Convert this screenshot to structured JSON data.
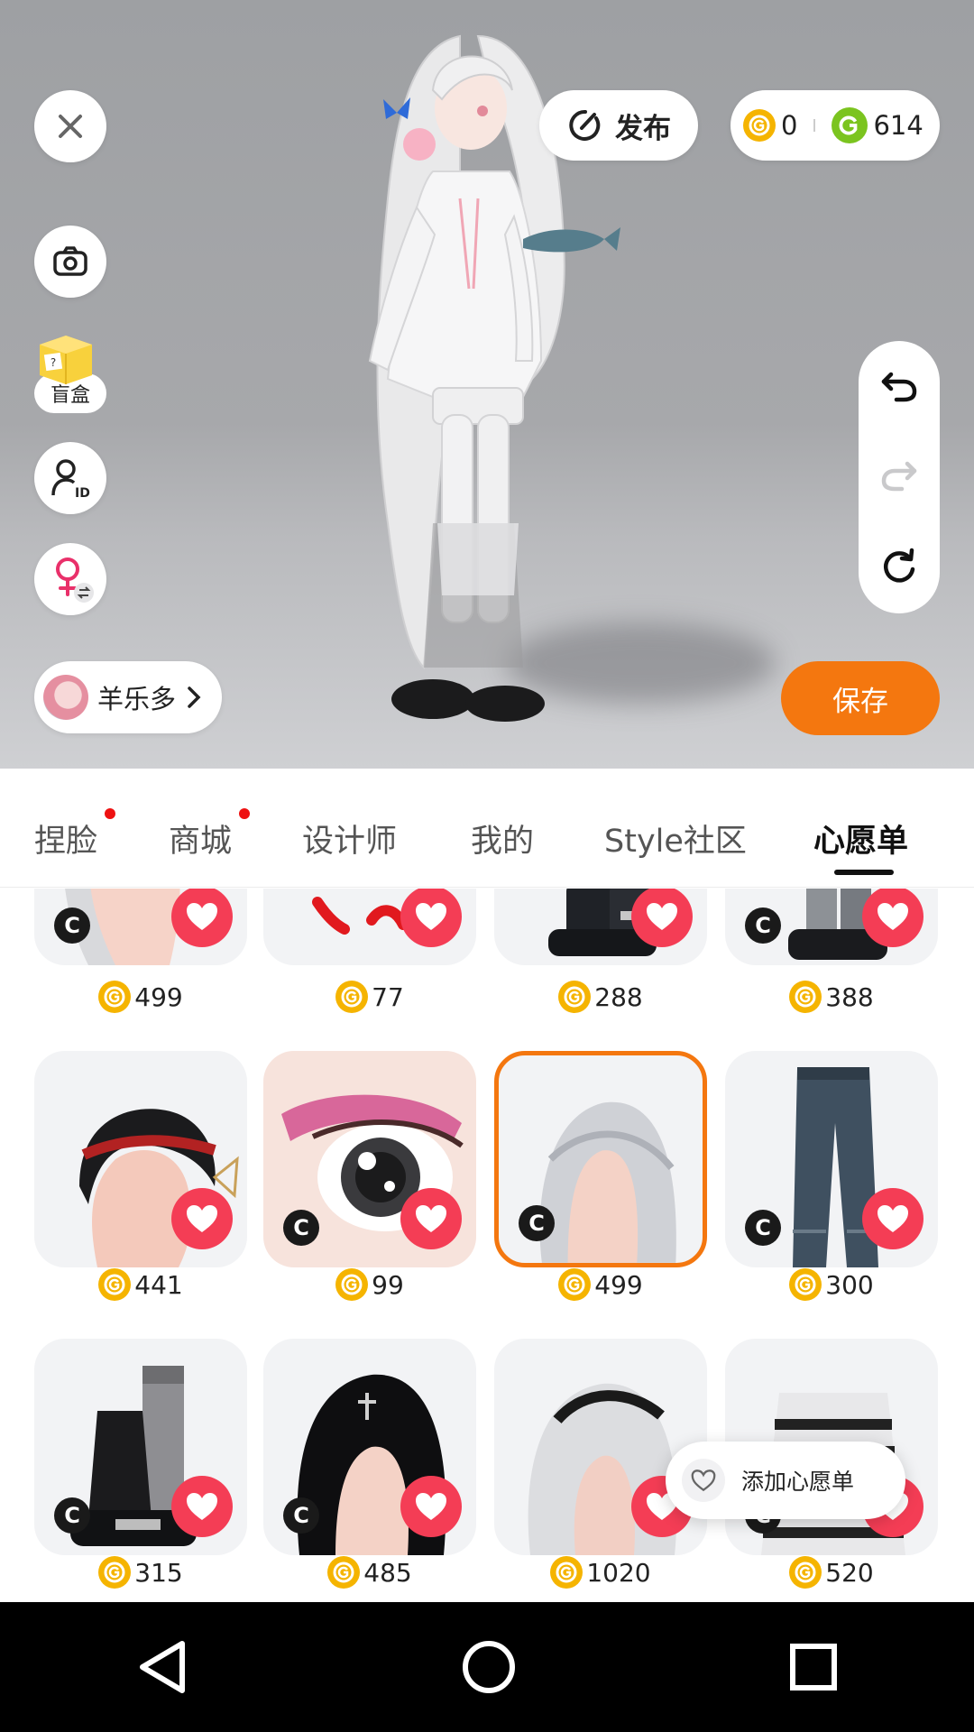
{
  "viewer": {
    "publish_label": "发布",
    "gold_balance": "0",
    "green_balance": "614",
    "blindbox_label": "盲盒",
    "user_name": "羊乐多",
    "save_label": "保存",
    "blindbox_mark": "?"
  },
  "tabs": [
    {
      "label": "捏脸",
      "dot": true
    },
    {
      "label": "商城",
      "dot": true
    },
    {
      "label": "设计师",
      "dot": false
    },
    {
      "label": "我的",
      "dot": false
    },
    {
      "label": "Style社区",
      "dot": false
    },
    {
      "label": "心愿单",
      "dot": false,
      "active": true
    }
  ],
  "badge_text": "C",
  "items": [
    {
      "price": "499",
      "creator": true,
      "thumb": "hair-silver"
    },
    {
      "price": "77",
      "creator": false,
      "thumb": "red-mark"
    },
    {
      "price": "288",
      "creator": false,
      "thumb": "boots-black"
    },
    {
      "price": "388",
      "creator": true,
      "thumb": "platform-boots"
    },
    {
      "price": "441",
      "creator": false,
      "thumb": "hair-black-ribbon"
    },
    {
      "price": "99",
      "creator": true,
      "thumb": "eye-pink"
    },
    {
      "price": "499",
      "creator": true,
      "thumb": "hair-long-silver",
      "selected": true
    },
    {
      "price": "300",
      "creator": true,
      "thumb": "jeans"
    },
    {
      "price": "315",
      "creator": true,
      "thumb": "leg-warmer-boots"
    },
    {
      "price": "485",
      "creator": true,
      "thumb": "hair-black-bangs"
    },
    {
      "price": "1020",
      "creator": false,
      "thumb": "hair-silver-headband"
    },
    {
      "price": "520",
      "creator": true,
      "thumb": "striped-sweater"
    }
  ],
  "popup": {
    "label": "添加心愿单"
  },
  "colors": {
    "accent": "#f4770f",
    "heart": "#f43d55",
    "coin": "#f5b400",
    "green_coin": "#7bc41f"
  }
}
